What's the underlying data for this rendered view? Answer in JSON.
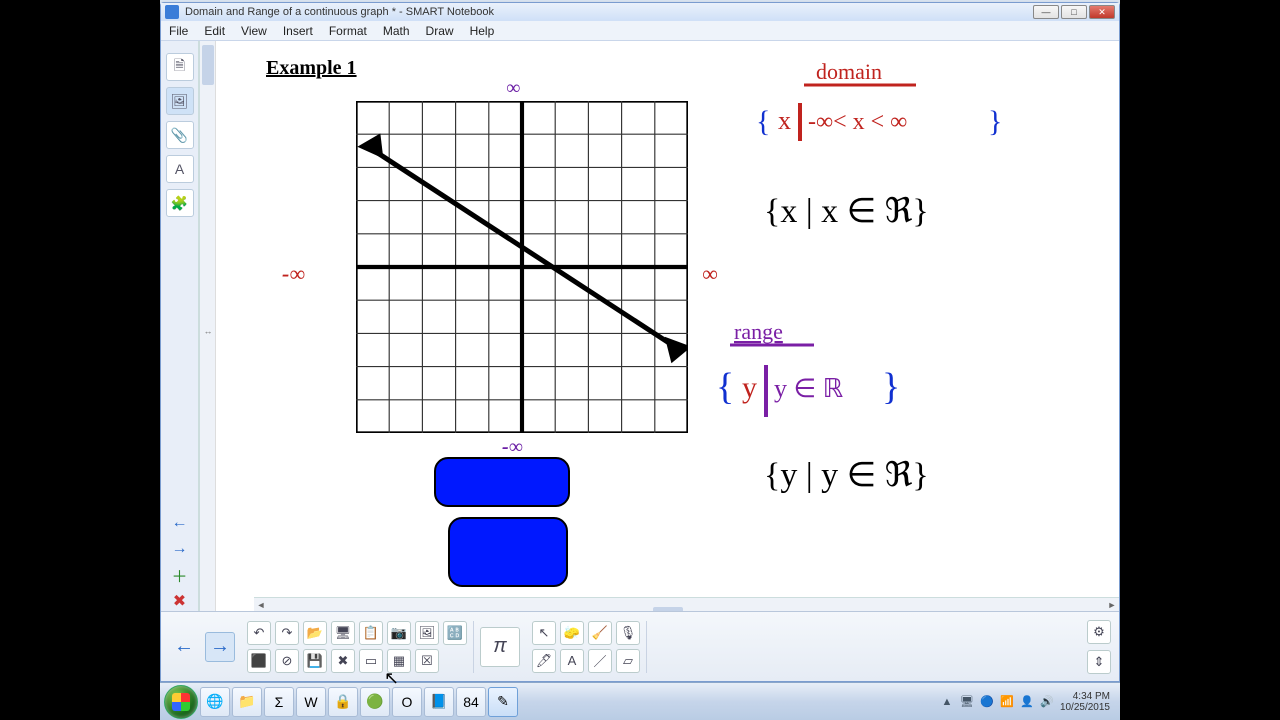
{
  "window": {
    "title": "Domain and Range of a continuous graph * - SMART Notebook",
    "controls": {
      "min": "—",
      "max": "□",
      "close": "✕"
    }
  },
  "menu": {
    "file": "File",
    "edit": "Edit",
    "view": "View",
    "insert": "Insert",
    "format": "Format",
    "math": "Math",
    "draw": "Draw",
    "help": "Help"
  },
  "leftTools": {
    "new": "🗎",
    "gallery": "🖼",
    "attach": "📎",
    "text": "A",
    "addon": "🧩"
  },
  "leftNav": {
    "prev": "←",
    "next": "→",
    "addpg": "＋",
    "delpg": "✖"
  },
  "canvas": {
    "title": "Example 1",
    "inf_top": "∞",
    "inf_left": "-∞",
    "inf_right": "∞",
    "inf_bot": "-∞",
    "domain_word": "domain",
    "domain_set": "{ x | -∞ < x < ∞ }",
    "set_x": "{x | x ∈ ℜ}",
    "range_word": "range",
    "range_set": "{ y | y ∈ ℜ }",
    "set_y": "{y | y ∈ ℜ}"
  },
  "bottomToolbar": {
    "prev": "←",
    "next": "→",
    "row1": [
      "↶",
      "↷",
      "📂",
      "🖥",
      "📋",
      "📷",
      "🖼",
      "🔠"
    ],
    "row2": [
      "⬛",
      "⊘",
      "💾",
      "✖",
      "▭",
      "▦",
      "☒"
    ],
    "pi": "π",
    "rowTools1": [
      "↖",
      "🧽",
      "🧹",
      "🎙"
    ],
    "rowTools2": [
      "🖊",
      "A",
      "／",
      "▱"
    ],
    "gear": "⚙",
    "expand": "⇕"
  },
  "taskbar": {
    "apps": [
      "🌐",
      "📁",
      "Σ",
      "W",
      "🔒",
      "🟢",
      "O",
      "📘",
      "84",
      "✎"
    ],
    "tray": [
      "▲",
      "🖥",
      "🔵",
      "📶",
      "👤",
      "🔊"
    ],
    "time": "4:34 PM",
    "date": "10/25/2015"
  }
}
